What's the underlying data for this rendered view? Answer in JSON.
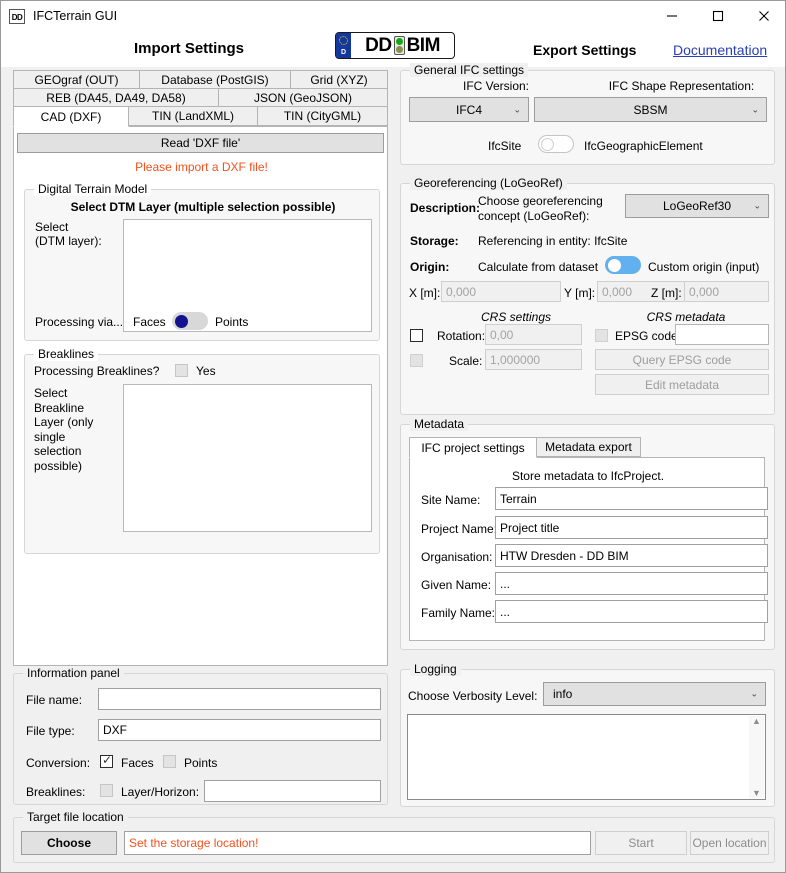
{
  "window": {
    "title": "IFCTerrain GUI",
    "icon_label": "DD",
    "minimize": "minimize-icon",
    "maximize": "maximize-icon",
    "close": "close-icon"
  },
  "header": {
    "import_title": "Import Settings",
    "export_title": "Export Settings",
    "documentation": "Documentation",
    "logo": {
      "country": "D",
      "left_text": "DD",
      "right_text": "BIM",
      "lamp_top_color": "#13a813",
      "lamp_bottom_color": "#8a8f4a"
    }
  },
  "import": {
    "tabs_row1": [
      {
        "label": "GEOgraf (OUT)",
        "selected": false
      },
      {
        "label": "Database (PostGIS)",
        "selected": false
      },
      {
        "label": "Grid (XYZ)",
        "selected": false
      }
    ],
    "tabs_row2": [
      {
        "label": "REB (DA45, DA49, DA58)",
        "selected": false
      },
      {
        "label": "JSON (GeoJSON)",
        "selected": false
      }
    ],
    "tabs_row3": [
      {
        "label": "CAD (DXF)",
        "selected": true
      },
      {
        "label": "TIN (LandXML)",
        "selected": false
      },
      {
        "label": "TIN (CityGML)",
        "selected": false
      }
    ],
    "read_button": "Read 'DXF file'",
    "warning": "Please import a DXF file!",
    "dtm": {
      "group_title": "Digital Terrain Model",
      "heading": "Select DTM Layer (multiple selection possible)",
      "select_label_line1": "Select",
      "select_label_line2": "(DTM layer):",
      "list_items": [],
      "processing_label": "Processing via...",
      "toggle_left": "Faces",
      "toggle_right": "Points",
      "toggle_state": "left"
    },
    "breaklines": {
      "group_title": "Breaklines",
      "question": "Processing Breaklines?",
      "yes_label": "Yes",
      "yes_checked": false,
      "select_label": "Select Breakline Layer (only single selection possible)",
      "list_items": []
    }
  },
  "export": {
    "general": {
      "group_title": "General IFC settings",
      "ifc_version_label": "IFC Version:",
      "ifc_version_value": "IFC4",
      "shape_rep_label": "IFC Shape Representation:",
      "shape_rep_value": "SBSM",
      "toggle_left": "IfcSite",
      "toggle_right": "IfcGeographicElement",
      "toggle_state": "left"
    },
    "georef": {
      "group_title": "Georeferencing (LoGeoRef)",
      "description_label": "Description:",
      "description_text_line1": "Choose georeferencing",
      "description_text_line2": "concept (LoGeoRef):",
      "logeoref_value": "LoGeoRef30",
      "storage_label": "Storage:",
      "storage_text": "Referencing in entity: IfcSite",
      "origin_label": "Origin:",
      "origin_left": "Calculate from dataset",
      "origin_right": "Custom origin (input)",
      "origin_toggle_state": "left",
      "x_label": "X [m]:",
      "x_value": "0,000",
      "y_label": "Y [m]:",
      "y_value": "0,000",
      "z_label": "Z [m]:",
      "z_value": "0,000",
      "crs_settings_title": "CRS settings",
      "crs_metadata_title": "CRS metadata",
      "rotation_label": "Rotation:",
      "rotation_value": "0,00",
      "rotation_checked": false,
      "scale_label": "Scale:",
      "scale_value": "1,000000",
      "scale_checked": false,
      "epsg_label": "EPSG code:",
      "epsg_value": "",
      "epsg_checked": false,
      "query_epsg_button": "Query EPSG code",
      "edit_metadata_button": "Edit metadata"
    },
    "metadata": {
      "group_title": "Metadata",
      "tabs": [
        {
          "label": "IFC project settings",
          "selected": true
        },
        {
          "label": "Metadata export",
          "selected": false
        }
      ],
      "heading": "Store metadata to IfcProject.",
      "fields": [
        {
          "label": "Site Name:",
          "value": "Terrain"
        },
        {
          "label": "Project Name:",
          "value": "Project title"
        },
        {
          "label": "Organisation:",
          "value": "HTW Dresden - DD BIM"
        },
        {
          "label": "Given Name:",
          "value": "..."
        },
        {
          "label": "Family Name:",
          "value": "..."
        }
      ]
    },
    "logging": {
      "group_title": "Logging",
      "verbosity_label": "Choose Verbosity Level:",
      "verbosity_value": "info",
      "log_text": ""
    }
  },
  "info_panel": {
    "group_title": "Information panel",
    "file_name_label": "File name:",
    "file_name_value": "",
    "file_type_label": "File type:",
    "file_type_value": "DXF",
    "conversion_label": "Conversion:",
    "conv_faces_label": "Faces",
    "conv_faces_checked": true,
    "conv_points_label": "Points",
    "conv_points_checked": false,
    "breaklines_label": "Breaklines:",
    "breaklines_checked": false,
    "layer_horizon_label": "Layer/Horizon:",
    "layer_horizon_value": ""
  },
  "target": {
    "group_title": "Target file location",
    "choose_button": "Choose",
    "path_warning": "Set the storage location!",
    "start_button": "Start",
    "open_location_button": "Open location"
  }
}
